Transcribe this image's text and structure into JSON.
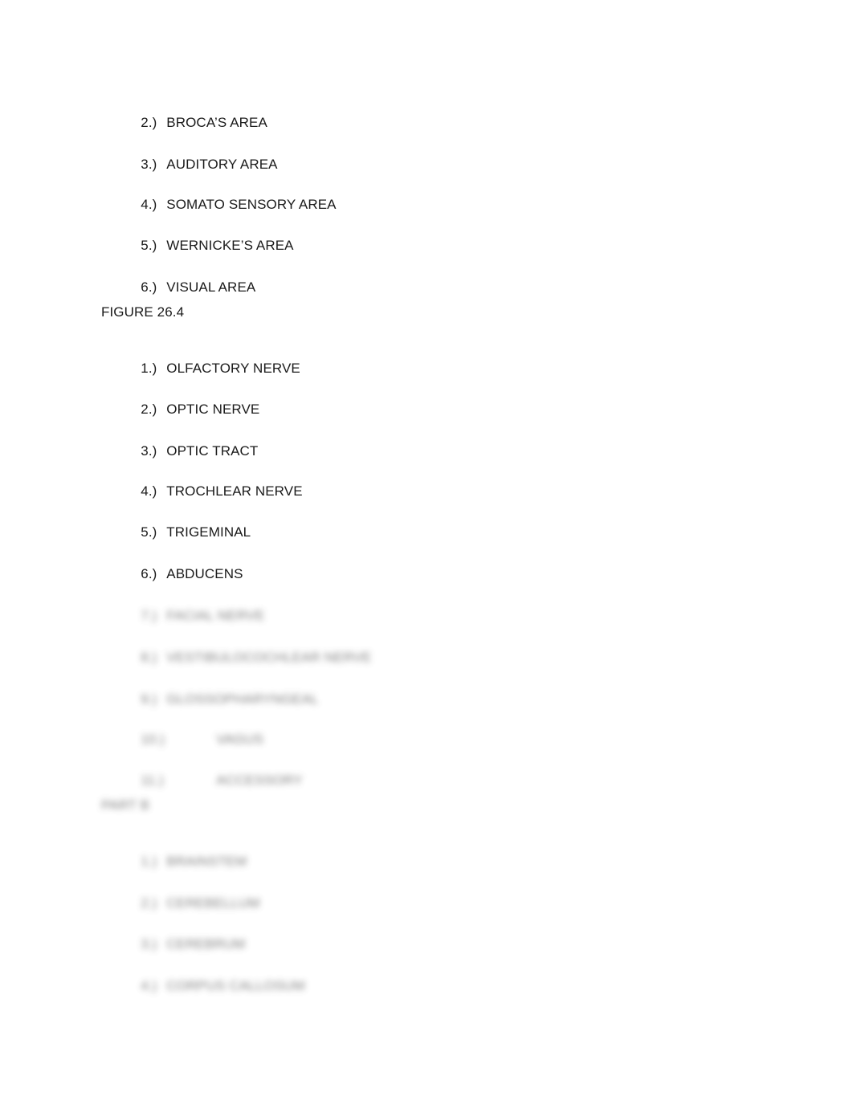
{
  "document": {
    "section_a_items": [
      {
        "num": "2.)",
        "label": "BROCA’S AREA"
      },
      {
        "num": "3.)",
        "label": "AUDITORY AREA"
      },
      {
        "num": "4.)",
        "label": "SOMATO SENSORY AREA"
      },
      {
        "num": "5.)",
        "label": "WERNICKE’S AREA"
      },
      {
        "num": "6.)",
        "label": "VISUAL AREA"
      }
    ],
    "figure_heading": "FIGURE 26.4",
    "figure_items": [
      {
        "num": "1.)",
        "label": "OLFACTORY NERVE"
      },
      {
        "num": "2.)",
        "label": "OPTIC NERVE"
      },
      {
        "num": "3.)",
        "label": "OPTIC TRACT"
      },
      {
        "num": "4.)",
        "label": "TROCHLEAR NERVE"
      },
      {
        "num": "5.)",
        "label": "TRIGEMINAL"
      },
      {
        "num": "6.)",
        "label": "ABDUCENS"
      }
    ],
    "blurred_figure_items": [
      {
        "num": "7.)",
        "label": "FACIAL NERVE"
      },
      {
        "num": "8.)",
        "label": "VESTIBULOCOCHLEAR NERVE"
      },
      {
        "num": "9.)",
        "label": "GLOSSOPHARYNGEAL"
      },
      {
        "num": "10.)",
        "label": "VAGUS"
      },
      {
        "num": "11.)",
        "label": "ACCESSORY"
      }
    ],
    "blurred_heading": "PART B",
    "blurred_part_items": [
      {
        "num": "1.)",
        "label": "BRAINSTEM"
      },
      {
        "num": "2.)",
        "label": "CEREBELLUM"
      },
      {
        "num": "3.)",
        "label": "CEREBRUM"
      },
      {
        "num": "4.)",
        "label": "CORPUS CALLOSUM"
      }
    ]
  }
}
